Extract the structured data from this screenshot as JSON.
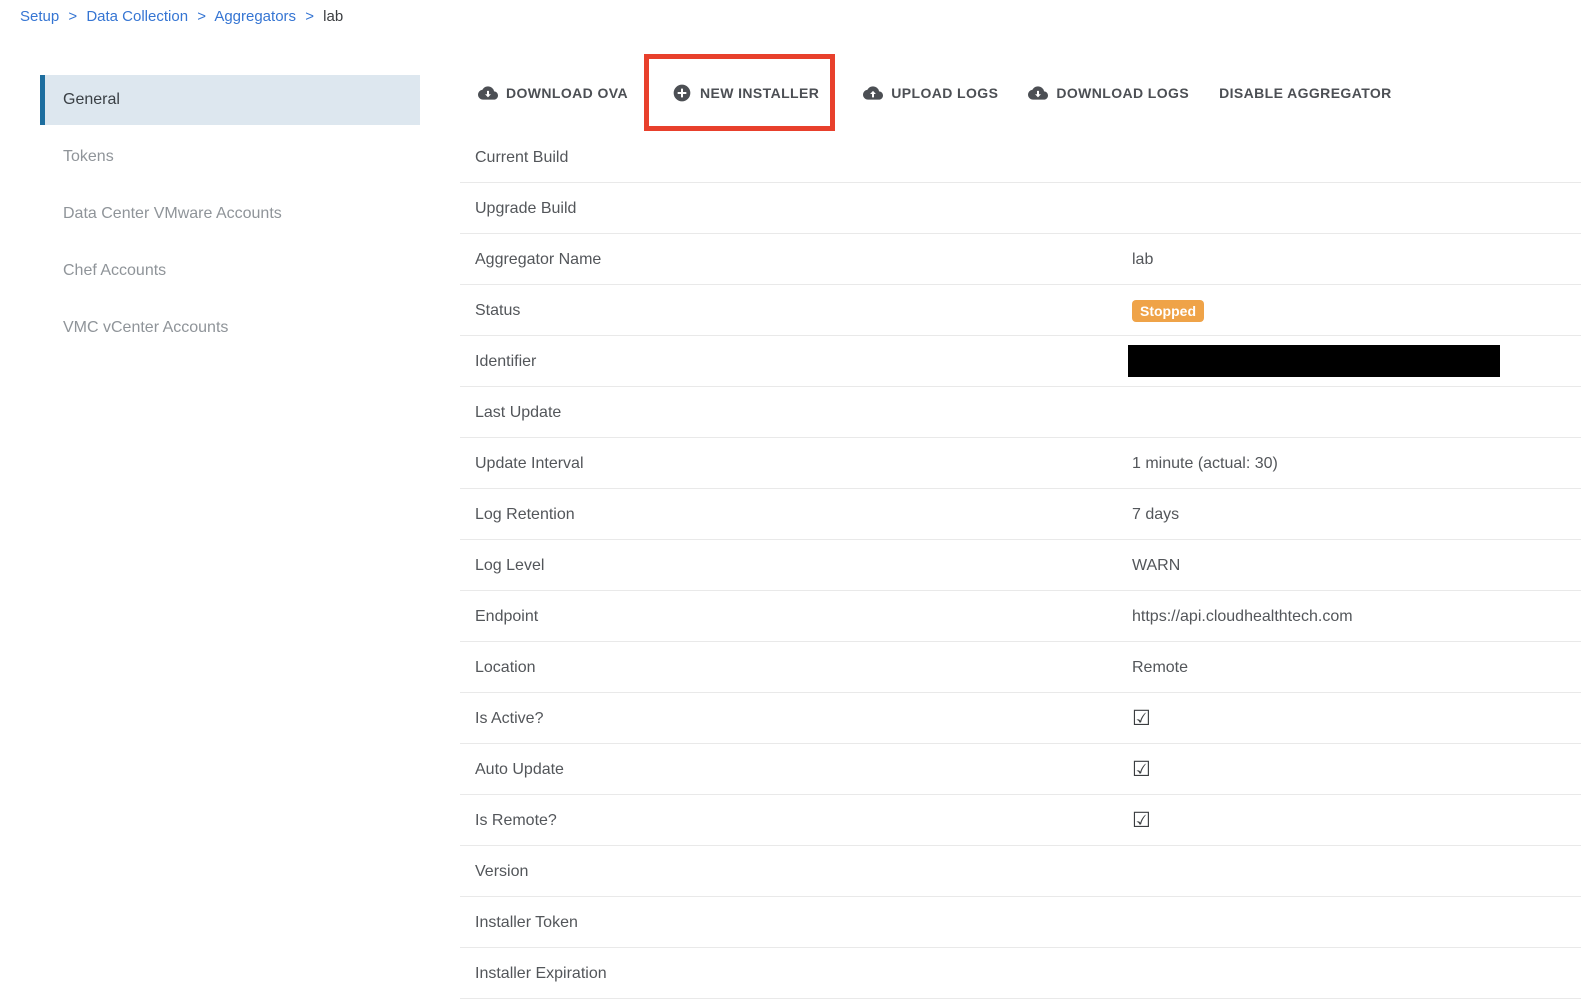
{
  "breadcrumb": {
    "links": [
      "Setup",
      "Data Collection",
      "Aggregators"
    ],
    "separator": ">",
    "current": "lab"
  },
  "sidebar": {
    "items": [
      {
        "label": "General",
        "selected": true
      },
      {
        "label": "Tokens",
        "selected": false
      },
      {
        "label": "Data Center VMware Accounts",
        "selected": false
      },
      {
        "label": "Chef Accounts",
        "selected": false
      },
      {
        "label": "VMC vCenter Accounts",
        "selected": false
      }
    ],
    "selected_bg": "#dde7ef",
    "selected_bar_color": "#1d6e9f"
  },
  "toolbar": {
    "buttons": [
      {
        "label": "DOWNLOAD OVA",
        "icon": "cloud-download-icon"
      },
      {
        "label": "NEW INSTALLER",
        "icon": "plus-circle-icon",
        "highlighted": true
      },
      {
        "label": "UPLOAD LOGS",
        "icon": "cloud-upload-icon"
      },
      {
        "label": "DOWNLOAD LOGS",
        "icon": "cloud-download-icon"
      },
      {
        "label": "DISABLE AGGREGATOR",
        "icon": null
      }
    ],
    "highlight_color": "#e8402c"
  },
  "details": {
    "rows": [
      {
        "label": "Current Build",
        "value": "",
        "type": "text"
      },
      {
        "label": "Upgrade Build",
        "value": "",
        "type": "text"
      },
      {
        "label": "Aggregator Name",
        "value": "lab",
        "type": "text"
      },
      {
        "label": "Status",
        "value": "Stopped",
        "type": "badge",
        "badge_color": "#efa348"
      },
      {
        "label": "Identifier",
        "value": "",
        "type": "redacted"
      },
      {
        "label": "Last Update",
        "value": "",
        "type": "text"
      },
      {
        "label": "Update Interval",
        "value": "1 minute (actual: 30)",
        "type": "text"
      },
      {
        "label": "Log Retention",
        "value": "7 days",
        "type": "text"
      },
      {
        "label": "Log Level",
        "value": "WARN",
        "type": "text"
      },
      {
        "label": "Endpoint",
        "value": "https://api.cloudhealthtech.com",
        "type": "text"
      },
      {
        "label": "Location",
        "value": "Remote",
        "type": "text"
      },
      {
        "label": "Is Active?",
        "value": "checked",
        "type": "checkbox"
      },
      {
        "label": "Auto Update",
        "value": "checked",
        "type": "checkbox"
      },
      {
        "label": "Is Remote?",
        "value": "checked",
        "type": "checkbox"
      },
      {
        "label": "Version",
        "value": "",
        "type": "text"
      },
      {
        "label": "Installer Token",
        "value": "",
        "type": "text"
      },
      {
        "label": "Installer Expiration",
        "value": "",
        "type": "text"
      }
    ]
  },
  "icons": {
    "checked_checkbox": "☑"
  }
}
